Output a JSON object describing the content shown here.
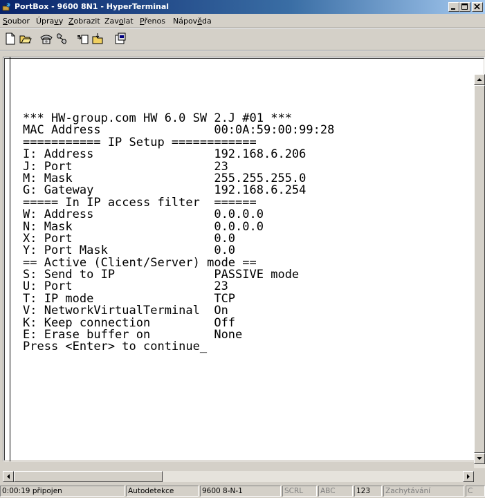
{
  "window": {
    "title": "PortBox - 9600 8N1 - HyperTerminal"
  },
  "menu": [
    {
      "label": "Soubor",
      "hot": "S",
      "rest": "oubor"
    },
    {
      "label": "Úpravy",
      "pre": "Úpra",
      "hot": "v",
      "rest": "y"
    },
    {
      "label": "Zobrazit",
      "hot": "Z",
      "rest": "obrazit"
    },
    {
      "label": "Zavolat",
      "pre": "Zav",
      "hot": "o",
      "rest": "lat"
    },
    {
      "label": "Přenos",
      "hot": "P",
      "rest": "řenos"
    },
    {
      "label": "Nápověda",
      "pre": "Nápov",
      "hot": "ě",
      "rest": "da"
    }
  ],
  "toolbar": [
    "new-icon",
    "open-icon",
    "call-icon",
    "disconnect-icon",
    "send-icon",
    "receive-icon",
    "properties-icon"
  ],
  "terminal": {
    "lines": [
      "*** HW-group.com HW 6.0 SW 2.J #01 ***",
      "MAC Address                00:0A:59:00:99:28",
      "=========== IP Setup ============",
      "I: Address                 192.168.6.206",
      "J: Port                    23",
      "M: Mask                    255.255.255.0",
      "G: Gateway                 192.168.6.254",
      "===== In IP access filter  ======",
      "W: Address                 0.0.0.0",
      "N: Mask                    0.0.0.0",
      "X: Port                    0.0",
      "Y: Port Mask               0.0",
      "== Active (Client/Server) mode ==",
      "S: Send to IP              PASSIVE mode",
      "U: Port                    23",
      "T: IP mode                 TCP",
      "V: NetworkVirtualTerminal  On",
      "K: Keep connection         Off",
      "E: Erase buffer on         None",
      "Press <Enter> to continue_"
    ]
  },
  "status": {
    "time": "0:00:19 připojen",
    "detect": "Autodetekce",
    "params": "9600 8-N-1",
    "scrl": "SCRL",
    "abc": "ABC",
    "num": "123",
    "capture": "Zachytávání",
    "extra": "C"
  }
}
